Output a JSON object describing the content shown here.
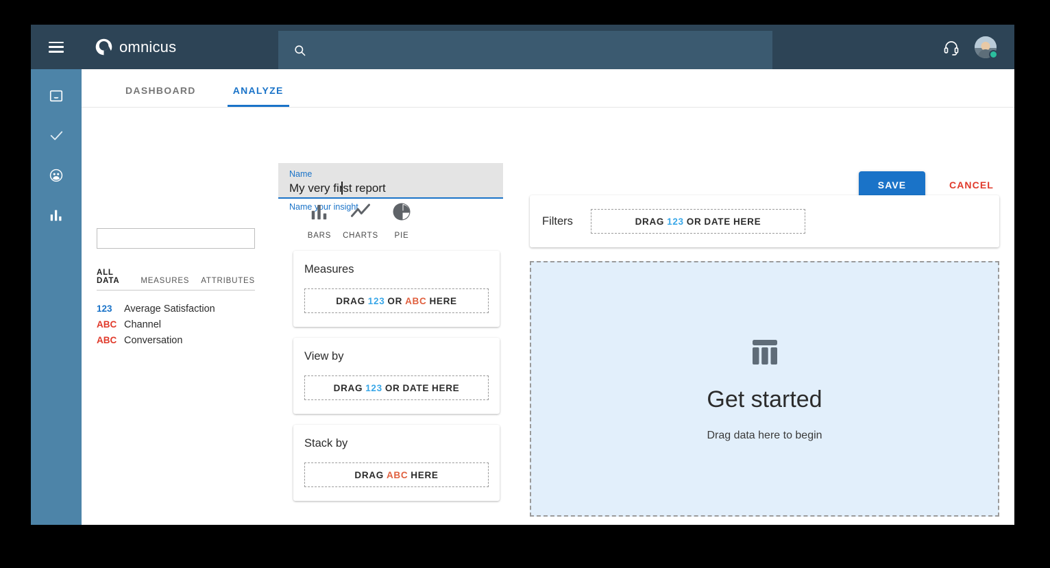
{
  "header": {
    "menu_icon": "hamburger-menu-icon",
    "brand": "omnicus",
    "brand_icon": "omnicus-logo-icon",
    "search": {
      "value": "",
      "placeholder": "",
      "icon": "search-icon"
    },
    "support_icon": "headset-icon",
    "avatar": "user-avatar",
    "status": "online"
  },
  "rail": {
    "items": [
      {
        "name": "inbox-icon",
        "label": "Inbox"
      },
      {
        "name": "check-icon",
        "label": "Tasks"
      },
      {
        "name": "people-icon",
        "label": "Contacts"
      },
      {
        "name": "bar-chart-icon",
        "label": "Analytics"
      }
    ]
  },
  "tabs": [
    {
      "label": "DASHBOARD",
      "active": false
    },
    {
      "label": "ANALYZE",
      "active": true
    }
  ],
  "name_field": {
    "label": "Name",
    "value": "My very first report",
    "hint": "Name your insight"
  },
  "actions": {
    "save_label": "SAVE",
    "cancel_label": "CANCEL"
  },
  "data_panel": {
    "search_value": "",
    "search_placeholder": "",
    "tabs": [
      {
        "label": "ALL DATA",
        "active": true
      },
      {
        "label": "MEASURES",
        "active": false
      },
      {
        "label": "ATTRIBUTES",
        "active": false
      }
    ],
    "fields": [
      {
        "badge": "123",
        "type": "measure",
        "name": "Average Satisfaction"
      },
      {
        "badge": "ABC",
        "type": "attribute",
        "name": "Channel"
      },
      {
        "badge": "ABC",
        "type": "attribute",
        "name": "Conversation"
      }
    ]
  },
  "viz_types": [
    {
      "label": "BARS",
      "icon": "bar-chart-icon"
    },
    {
      "label": "CHARTS",
      "icon": "line-chart-icon"
    },
    {
      "label": "PIE",
      "icon": "pie-chart-icon"
    }
  ],
  "shelves": [
    {
      "title": "Measures",
      "drop": {
        "prefix": "DRAG",
        "token1": "123",
        "middle": "OR",
        "token2": "ABC",
        "suffix": "HERE"
      }
    },
    {
      "title": "View by",
      "drop": {
        "prefix": "DRAG",
        "token1": "123",
        "middle": "OR",
        "token2": "DATE",
        "suffix": "HERE"
      }
    },
    {
      "title": "Stack by",
      "drop": {
        "prefix": "DRAG",
        "token1": "",
        "middle": "",
        "token2": "ABC",
        "suffix": "HERE"
      }
    }
  ],
  "filters": {
    "label": "Filters",
    "drop": {
      "prefix": "DRAG",
      "token1": "123",
      "middle": "OR",
      "token2": "DATE",
      "suffix": "HERE"
    }
  },
  "canvas": {
    "icon": "table-grid-icon",
    "title": "Get started",
    "subtitle": "Drag data here to begin"
  },
  "colors": {
    "header_bg": "#2d4456",
    "rail_bg": "#4d84a8",
    "accent": "#1a73c8",
    "danger": "#e0392a",
    "measure": "#1a73c8",
    "attribute": "#e0392a",
    "canvas_bg": "#e2effb",
    "status_online": "#2bbf9e"
  }
}
